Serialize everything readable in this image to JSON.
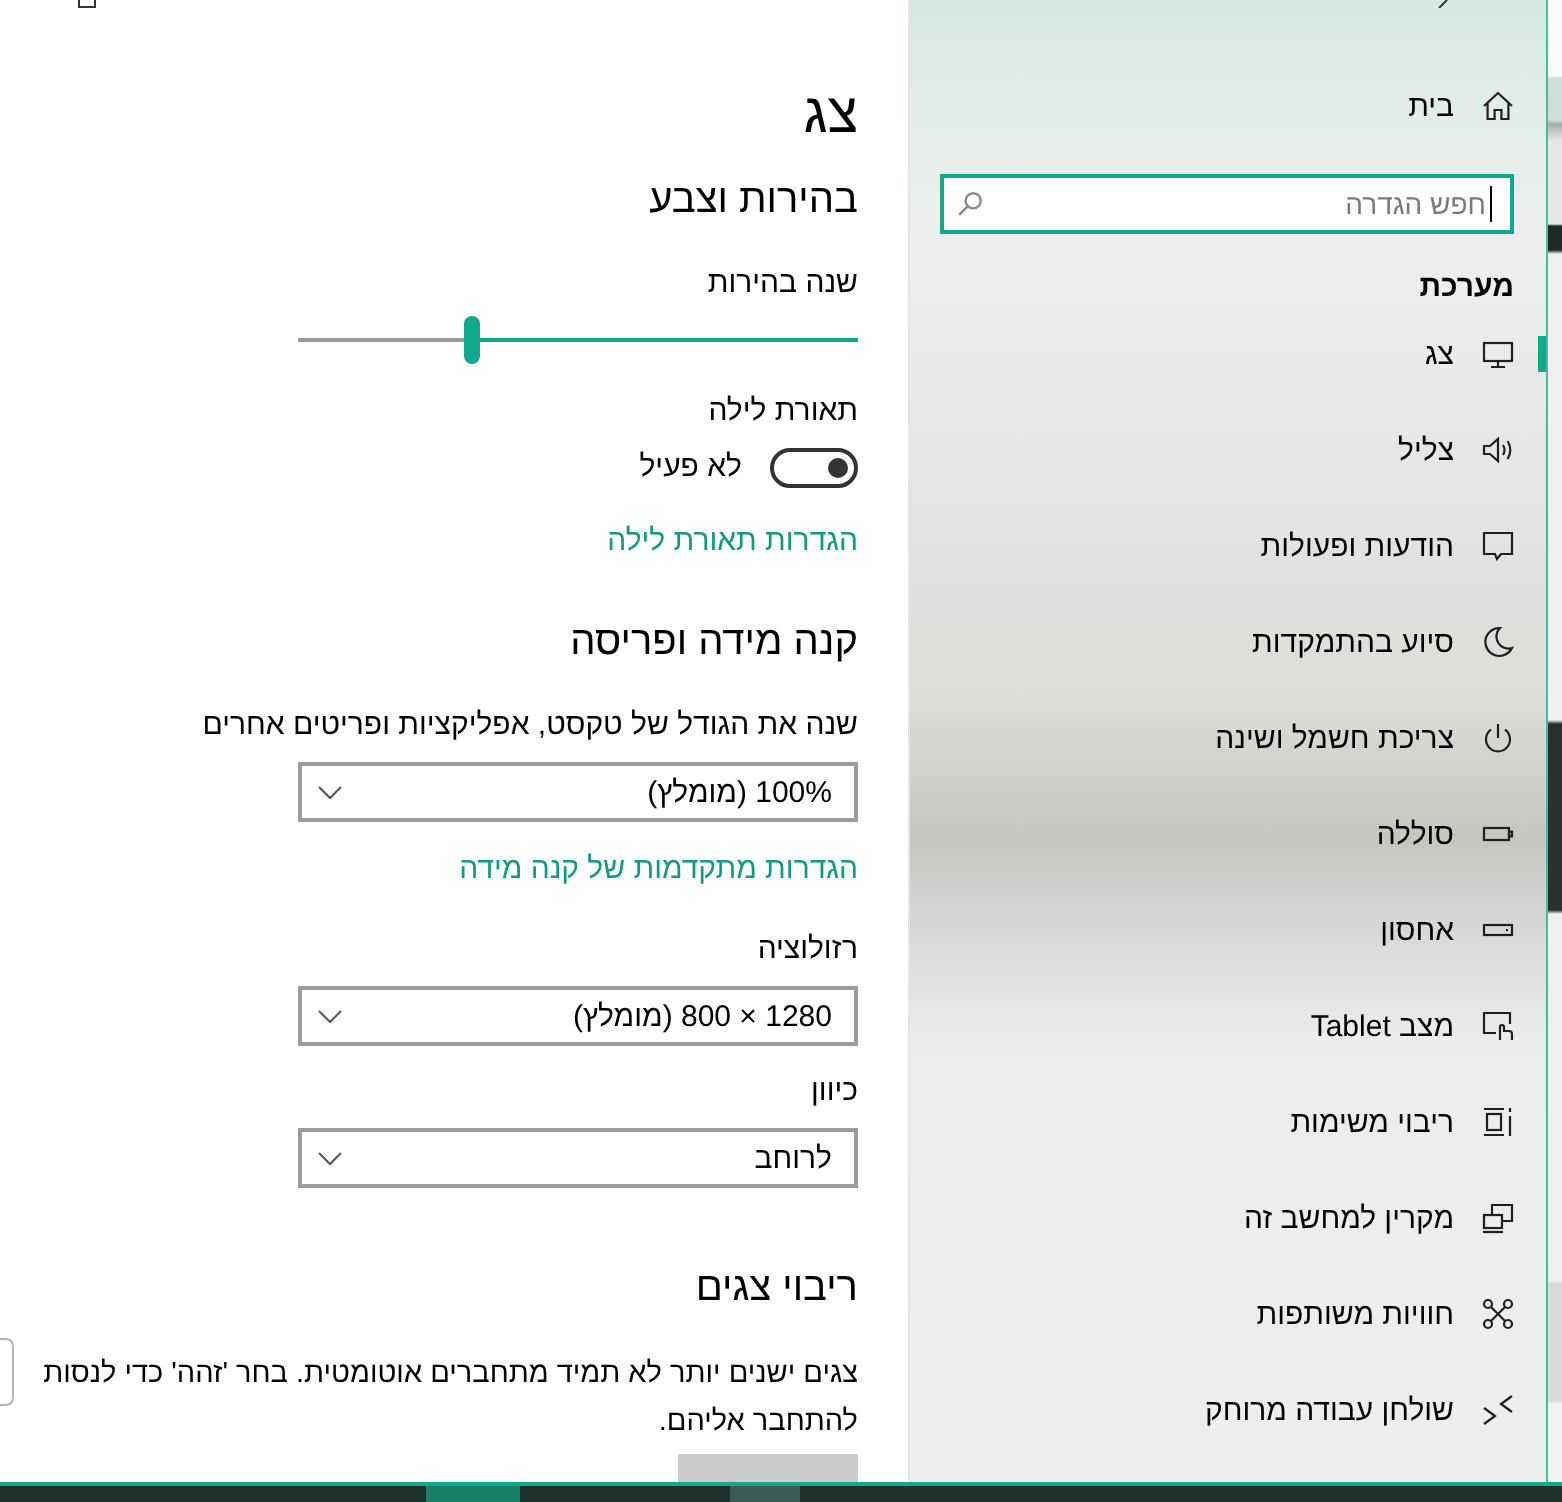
{
  "nav": {
    "home": {
      "label": "בית"
    },
    "search": {
      "placeholder": "חפש הגדרה",
      "focused": true
    },
    "section": "מערכת",
    "items": [
      {
        "label": "צג",
        "selected": true
      },
      {
        "label": "צליל",
        "selected": false
      },
      {
        "label": "הודעות ופעולות",
        "selected": false
      },
      {
        "label": "סיוע בהתמקדות",
        "selected": false
      },
      {
        "label": "צריכת חשמל ושינה",
        "selected": false
      },
      {
        "label": "סוללה",
        "selected": false
      },
      {
        "label": "אחסון",
        "selected": false
      },
      {
        "label": "מצב Tablet",
        "selected": false
      },
      {
        "label": "ריבוי משימות",
        "selected": false
      },
      {
        "label": "מקרין למחשב זה",
        "selected": false
      },
      {
        "label": "חוויות משותפות",
        "selected": false
      },
      {
        "label": "שולחן עבודה מרוחק",
        "selected": false
      }
    ]
  },
  "content": {
    "title": "צג",
    "blocks": [
      {
        "kind": "heading",
        "text": "בהירות וצבע"
      },
      {
        "kind": "label",
        "text": "שנה בהירות"
      },
      {
        "kind": "slider",
        "level": 0.69
      },
      {
        "kind": "label",
        "text": "תאורת לילה"
      },
      {
        "kind": "toggle",
        "on": false,
        "state_text": "לא פעיל"
      },
      {
        "kind": "link",
        "text": "הגדרות תאורת לילה"
      },
      {
        "kind": "heading",
        "text": "קנה מידה ופריסה"
      },
      {
        "kind": "label",
        "text": "שנה את הגודל של טקסט, אפליקציות ופריטים אחרים"
      },
      {
        "kind": "dropdown",
        "value": "100% (מומלץ)"
      },
      {
        "kind": "link",
        "text": "הגדרות מתקדמות של קנה מידה"
      },
      {
        "kind": "label",
        "text": "רזולוציה"
      },
      {
        "kind": "dropdown",
        "value": "1280 × 800 (מומלץ)"
      },
      {
        "kind": "label",
        "text": "כיוון"
      },
      {
        "kind": "dropdown",
        "value": "לרוחב"
      },
      {
        "kind": "heading",
        "text": "ריבוי צגים"
      },
      {
        "kind": "paragraph",
        "text": "צגים ישנים יותר לא תמיד מתחברים אוטומטית. בחר 'זהה' כדי לנסות להתחבר אליהם."
      },
      {
        "kind": "button"
      }
    ]
  }
}
